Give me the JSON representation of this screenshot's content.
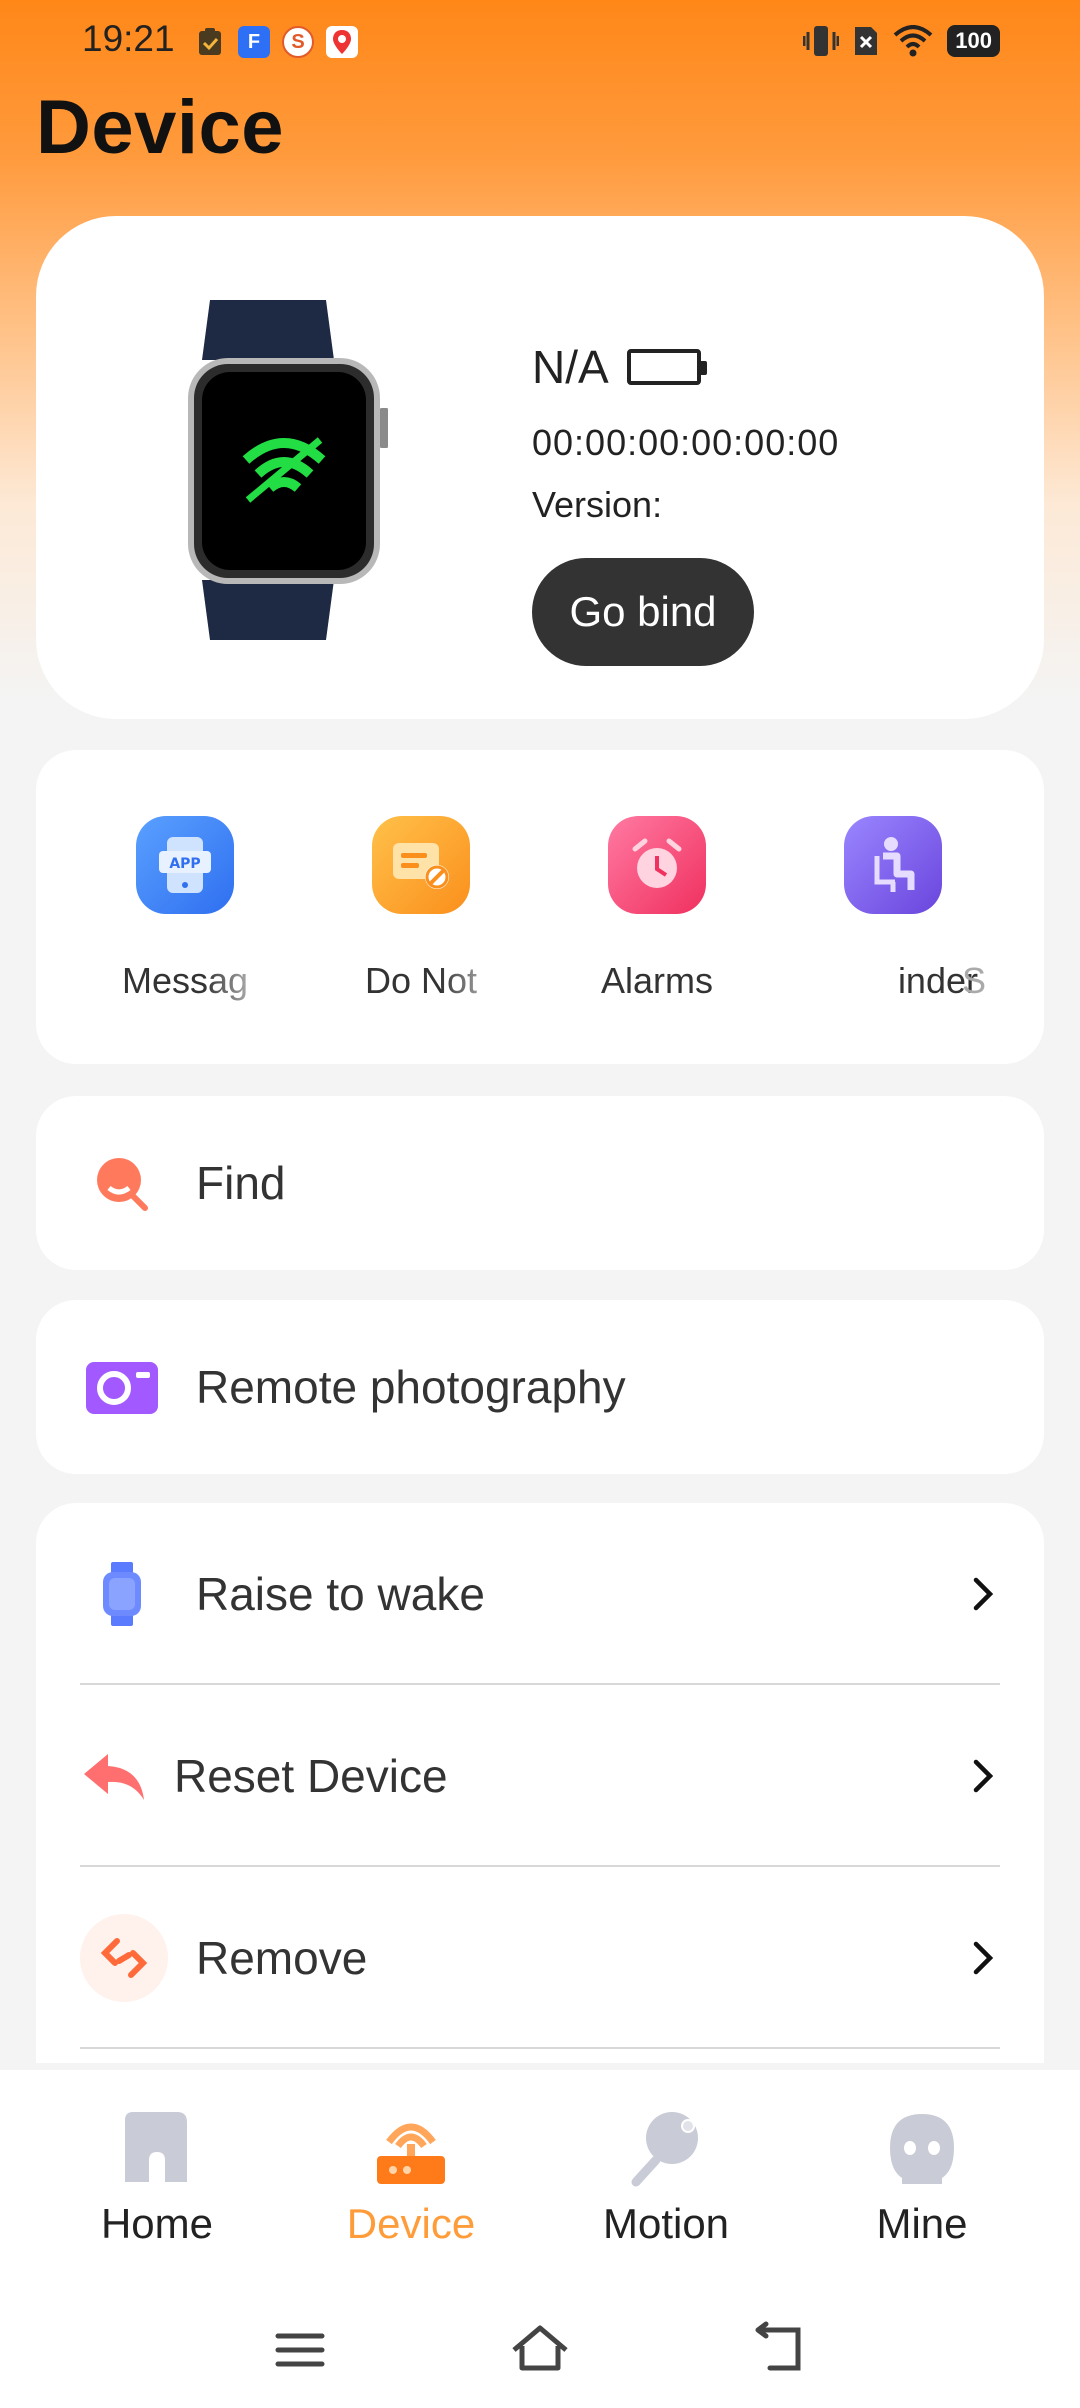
{
  "status_bar": {
    "time": "19:21",
    "battery": "100",
    "left_icons": [
      "clipboard-icon",
      "app-f-icon",
      "app-s-icon",
      "map-pin-icon"
    ],
    "right_icons": [
      "vibrate-icon",
      "sim-off-icon",
      "wifi-icon",
      "battery-icon"
    ]
  },
  "header": {
    "title": "Device"
  },
  "device_card": {
    "name": "N/A",
    "mac": "00:00:00:00:00:00",
    "version_label": "Version:",
    "bind_button": "Go bind",
    "screen_icon": "wifi-off-icon"
  },
  "quick_functions": [
    {
      "label": "Messag",
      "icon": "app-message-icon",
      "color": "#3b82f6"
    },
    {
      "label": "Do Not",
      "icon": "do-not-disturb-icon",
      "color": "#fb9a1c"
    },
    {
      "label": "Alarms",
      "icon": "alarm-clock-icon",
      "color": "#f0426f"
    },
    {
      "label": "inder",
      "icon": "sedentary-reminder-icon",
      "color": "#7c5ce6"
    },
    {
      "label": "S",
      "icon": "more-icon",
      "color": "#cccccc"
    }
  ],
  "find": {
    "label": "Find",
    "icon": "find-search-icon"
  },
  "remote_photo": {
    "label": "Remote photography",
    "icon": "camera-icon"
  },
  "settings": [
    {
      "label": "Raise to wake",
      "icon": "watch-icon"
    },
    {
      "label": "Reset Device",
      "icon": "reset-arrow-icon"
    },
    {
      "label": "Remove",
      "icon": "unlink-icon"
    }
  ],
  "bottom_nav": [
    {
      "label": "Home",
      "icon": "home-icon",
      "active": false
    },
    {
      "label": "Device",
      "icon": "device-icon",
      "active": true
    },
    {
      "label": "Motion",
      "icon": "ping-pong-icon",
      "active": false
    },
    {
      "label": "Mine",
      "icon": "user-face-icon",
      "active": false
    }
  ],
  "colors": {
    "accent": "#ff9c3a",
    "header_gradient_top": "#ff8718",
    "button_dark": "#333333"
  }
}
